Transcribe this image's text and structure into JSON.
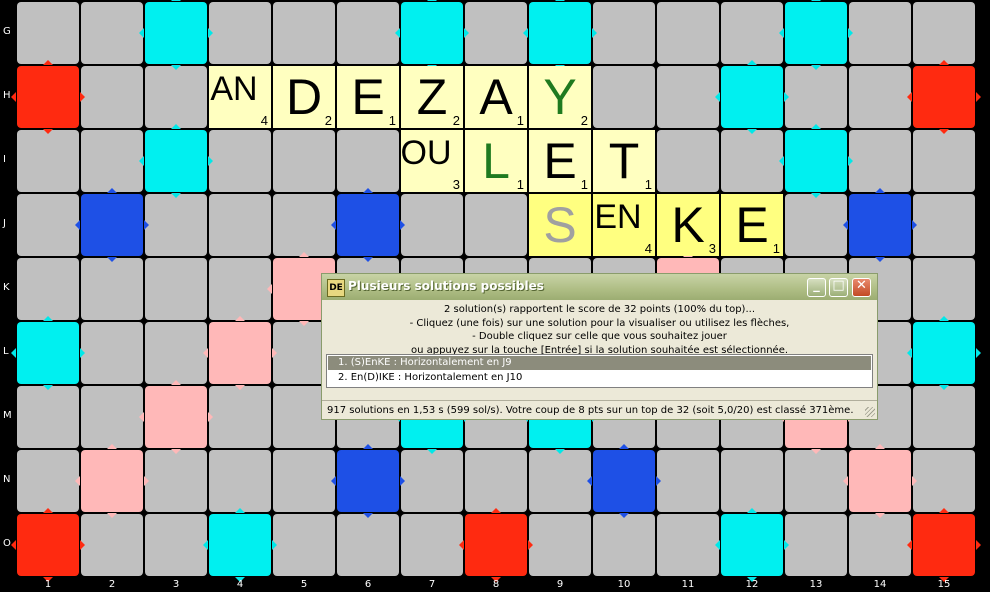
{
  "board": {
    "row_labels": [
      "G",
      "H",
      "I",
      "J",
      "K",
      "L",
      "M",
      "N",
      "O"
    ],
    "col_labels": [
      "1",
      "2",
      "3",
      "4",
      "5",
      "6",
      "7",
      "8",
      "9",
      "10",
      "11",
      "12",
      "13",
      "14",
      "15"
    ],
    "colors": {
      "plain": "#c0c0c0",
      "tw": "#ff2a10",
      "tl": "#1e50e6",
      "dw": "#ffb8b8",
      "dl": "#00f0f0",
      "tile": "#ffffc0",
      "tile_hl": "#ffff80"
    },
    "layout": [
      ".,.,dl,.,.,.,dl,.,dl,.,.,.,dl,.,.",
      "tw,.,.,.,.,.,.,.,.,.,.,dl,.,.,tw",
      ".,.,dl,.,.,.,.,.,.,.,.,.,dl,.,.",
      ".,tl,.,.,.,tl,.,.,.,.,.,.,.,tl,.",
      ".,.,.,.,dw,.,.,.,.,.,dw,.,.,.,.",
      "dl,.,.,dw,.,.,.,.,.,.,.,.,.,.,dl",
      ".,.,dw,.,.,.,dl,.,dl,.,.,.,dw,.,.",
      ".,dw,.,.,.,tl,.,.,.,tl,.,.,.,dw,.",
      "tw,.,.,dl,.,.,.,tw,.,.,.,dl,.,.,tw"
    ],
    "tiles": [
      {
        "row": 1,
        "col": 3,
        "letter": "AN",
        "points": "4",
        "style": "multi"
      },
      {
        "row": 1,
        "col": 4,
        "letter": "D",
        "points": "2",
        "style": ""
      },
      {
        "row": 1,
        "col": 5,
        "letter": "E",
        "points": "1",
        "style": ""
      },
      {
        "row": 1,
        "col": 6,
        "letter": "Z",
        "points": "2",
        "style": ""
      },
      {
        "row": 1,
        "col": 7,
        "letter": "A",
        "points": "1",
        "style": ""
      },
      {
        "row": 1,
        "col": 8,
        "letter": "Y",
        "points": "2",
        "style": "green"
      },
      {
        "row": 2,
        "col": 6,
        "letter": "OU",
        "points": "3",
        "style": "multi"
      },
      {
        "row": 2,
        "col": 7,
        "letter": "L",
        "points": "1",
        "style": "green"
      },
      {
        "row": 2,
        "col": 8,
        "letter": "E",
        "points": "1",
        "style": ""
      },
      {
        "row": 2,
        "col": 9,
        "letter": "T",
        "points": "1",
        "style": ""
      },
      {
        "row": 3,
        "col": 8,
        "letter": "S",
        "points": "",
        "style": "grey",
        "hl": true
      },
      {
        "row": 3,
        "col": 9,
        "letter": "EN",
        "points": "4",
        "style": "multi",
        "hl": true
      },
      {
        "row": 3,
        "col": 10,
        "letter": "K",
        "points": "3",
        "style": "",
        "hl": true
      },
      {
        "row": 3,
        "col": 11,
        "letter": "E",
        "points": "1",
        "style": "",
        "hl": true
      }
    ]
  },
  "dialog": {
    "icon_text": "DE",
    "title": "Plusieurs solutions possibles",
    "minimize_label": "_",
    "maximize_label": "□",
    "close_label": "✕",
    "message_lines": [
      "2 solution(s) rapportent le score de 32 points (100% du top)...",
      "- Cliquez (une fois) sur une solution pour la visualiser ou utilisez les flèches,",
      "- Double cliquez sur celle que vous souhaitez jouer",
      "ou appuyez sur la touche [Entrée] si la solution souhaitée est sélectionnée."
    ],
    "solutions": [
      "1. (S)EnKE : Horizontalement en J9",
      "2. En(D)IKE : Horizontalement en J10"
    ],
    "selected_index": 0,
    "status": "917 solutions en 1,53 s (599 sol/s). Votre coup de 8 pts sur un top de 32 (soit 5,0/20) est classé 371ème."
  }
}
